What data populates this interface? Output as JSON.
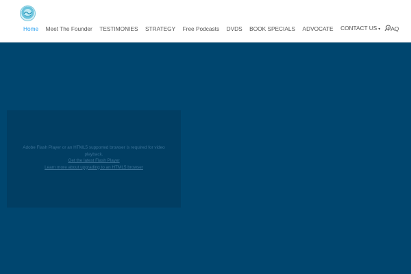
{
  "header": {
    "logo_icon": "logo-badge-icon",
    "nav": [
      {
        "label": "Home",
        "active": true
      },
      {
        "label": "Meet The Founder"
      },
      {
        "label": "TESTIMONIES"
      },
      {
        "label": "STRATEGY"
      },
      {
        "label": "Free Podcasts"
      },
      {
        "label": "DVDS"
      },
      {
        "label": "BOOK SPECIALS"
      },
      {
        "label": "ADVOCATE"
      },
      {
        "label": "CONTACT US",
        "has_dropdown": true
      },
      {
        "label": "FAQ"
      }
    ],
    "search_icon": "search-icon",
    "colors": {
      "active": "#2ea3f2",
      "text": "#555555"
    }
  },
  "hero": {
    "background": "#00466f",
    "video": {
      "message_line1": "Adobe Flash Player or an HTML5 supported browser is required for video",
      "message_line2": "playback.",
      "link1": "Get the latest Flash Player",
      "link2": "Learn more about upgrading to an HTML5 browser"
    }
  }
}
